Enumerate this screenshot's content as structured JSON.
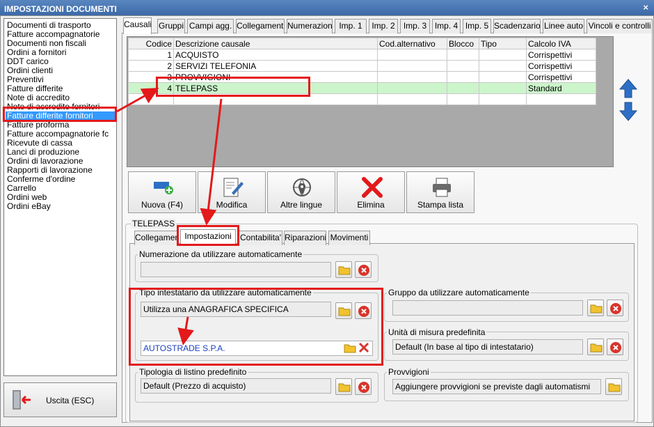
{
  "window": {
    "title": "IMPOSTAZIONI DOCUMENTI",
    "close": "×"
  },
  "sidebar": {
    "items": [
      {
        "label": "Documenti di trasporto"
      },
      {
        "label": "Fatture accompagnatorie"
      },
      {
        "label": "Documenti non fiscali"
      },
      {
        "label": "Ordini a fornitori"
      },
      {
        "label": "DDT carico"
      },
      {
        "label": "Ordini clienti"
      },
      {
        "label": "Preventivi"
      },
      {
        "label": "Fatture differite"
      },
      {
        "label": "Note di accredito"
      },
      {
        "label": "Note di accredito fornitori"
      },
      {
        "label": "Fatture differite fornitori"
      },
      {
        "label": "Fatture proforma"
      },
      {
        "label": "Fatture accompagnatorie fc"
      },
      {
        "label": "Ricevute di cassa"
      },
      {
        "label": "Lanci di produzione"
      },
      {
        "label": "Ordini di lavorazione"
      },
      {
        "label": "Rapporti di lavorazione"
      },
      {
        "label": "Conferme d'ordine"
      },
      {
        "label": "Carrello"
      },
      {
        "label": "Ordini web"
      },
      {
        "label": "Ordini eBay"
      }
    ],
    "selected_index": 10,
    "exit_label": "Uscita (ESC)"
  },
  "top_tabs": [
    "Causali",
    "Gruppi",
    "Campi agg.",
    "Collegamenti",
    "Numerazioni",
    "Imp. 1",
    "Imp. 2",
    "Imp. 3",
    "Imp. 4",
    "Imp. 5",
    "Scadenzario",
    "Linee auto",
    "Vincoli e controlli"
  ],
  "grid": {
    "columns": [
      "Codice",
      "Descrizione causale",
      "Cod.alternativo",
      "Blocco",
      "Tipo",
      "Calcolo IVA"
    ],
    "rows": [
      [
        "1",
        "ACQUISTO",
        "",
        "",
        "",
        "Corrispettivi"
      ],
      [
        "2",
        "SERVIZI TELEFONIA",
        "",
        "",
        "",
        "Corrispettivi"
      ],
      [
        "3",
        "PROVVIGIONI",
        "",
        "",
        "",
        "Corrispettivi"
      ],
      [
        "4",
        "TELEPASS",
        "",
        "",
        "",
        "Standard"
      ]
    ],
    "highlight_row": 3
  },
  "toolbar": {
    "buttons": [
      {
        "label": "Nuova (F4)",
        "icon": "new-record-icon"
      },
      {
        "label": "Modifica",
        "icon": "edit-icon"
      },
      {
        "label": "Altre lingue",
        "icon": "globe-icon"
      },
      {
        "label": "Elimina",
        "icon": "delete-icon"
      },
      {
        "label": "Stampa lista",
        "icon": "printer-icon"
      }
    ]
  },
  "detail": {
    "group_title": "TELEPASS",
    "tabs": [
      "Collegamenti",
      "Impostazioni",
      "Contabilita'",
      "Riparazioni",
      "Movimenti"
    ],
    "active_tab": 1,
    "numerazione": {
      "label": "Numerazione da utilizzare automaticamente",
      "value": ""
    },
    "tipo_intestatario": {
      "label": "Tipo intestatario da utilizzare automaticamente",
      "value": "Utilizza una ANAGRAFICA SPECIFICA",
      "anagrafica": "AUTOSTRADE S.P.A."
    },
    "tipologia_listino": {
      "label": "Tipologia di listino predefinito",
      "value": "Default (Prezzo di acquisto)"
    },
    "gruppo": {
      "label": "Gruppo da utilizzare automaticamente",
      "value": ""
    },
    "unita_misura": {
      "label": "Unità di misura predefinita",
      "value": "Default (In base al tipo di intestatario)"
    },
    "provvigioni": {
      "label": "Provvigioni",
      "value": "Aggiungere provvigioni se previste dagli automatismi"
    }
  },
  "colors": {
    "accent": "#3399ff",
    "highlight": "#e3191b",
    "row_highlight": "#ccf5cc"
  }
}
